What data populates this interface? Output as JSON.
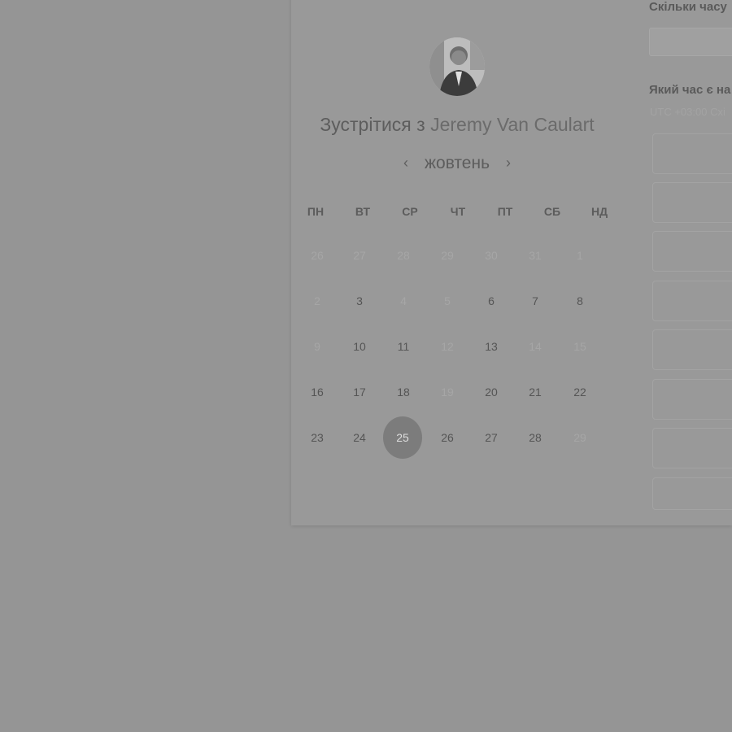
{
  "booking": {
    "title_prefix": "Зустрітися з",
    "host_name": "Jeremy Van Caulart"
  },
  "calendar": {
    "month": "жовтень",
    "prev_icon": "chevron-left-icon",
    "next_icon": "chevron-right-icon",
    "weekdays": [
      "ПН",
      "ВТ",
      "СР",
      "ЧТ",
      "ПТ",
      "СБ",
      "НД"
    ],
    "weeks": [
      [
        "26",
        "27",
        "28",
        "29",
        "30",
        "31",
        "1"
      ],
      [
        "2",
        "3",
        "4",
        "5",
        "6",
        "7",
        "8"
      ],
      [
        "9",
        "10",
        "11",
        "12",
        "13",
        "14",
        "15"
      ],
      [
        "16",
        "17",
        "18",
        "19",
        "20",
        "21",
        "22"
      ],
      [
        "23",
        "24",
        "25",
        "26",
        "27",
        "28",
        "29"
      ]
    ],
    "selected_day": "25"
  },
  "side_panel": {
    "duration_question": "Скільки часу",
    "time_question": "Який час є на",
    "timezone": "UTC +03:00 Схі"
  }
}
